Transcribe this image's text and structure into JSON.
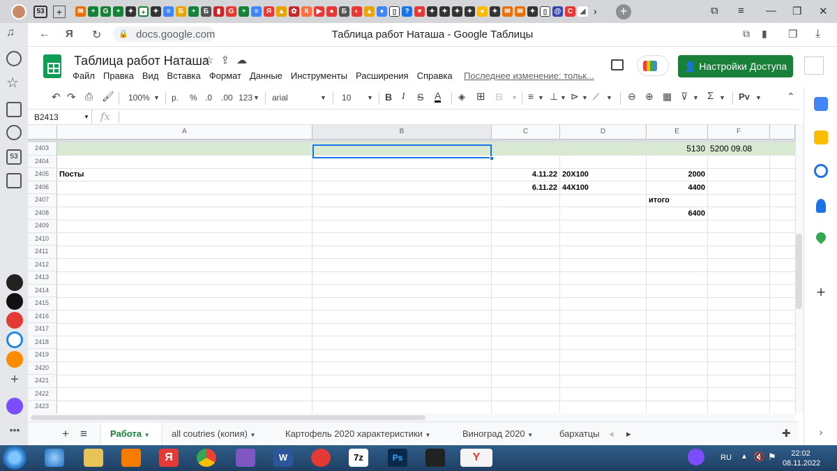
{
  "browser": {
    "tab_count": "53",
    "url": "docs.google.com",
    "page_title": "Таблица работ Наташа - Google Таблицы"
  },
  "doc": {
    "title": "Таблица работ Наташа",
    "menu": [
      "Файл",
      "Правка",
      "Вид",
      "Вставка",
      "Формат",
      "Данные",
      "Инструменты",
      "Расширения",
      "Справка"
    ],
    "last_edit": "Последнее изменение: тольк...",
    "share_label": "Настройки Доступа"
  },
  "toolbar": {
    "zoom": "100%",
    "currency": "р.",
    "percent": "%",
    "dec_less": ".0",
    "dec_more": ".00",
    "format_more": "123",
    "font": "arial",
    "font_size": "10"
  },
  "formula": {
    "namebox": "B2413",
    "fx": "fx"
  },
  "grid": {
    "columns": [
      "A",
      "B",
      "C",
      "D",
      "E",
      "F"
    ],
    "rows": [
      {
        "num": "2403",
        "a": "",
        "c": "",
        "d": "",
        "e": "5130",
        "f": "5200 09.08",
        "highlight": true
      },
      {
        "num": "2404",
        "a": "",
        "c": "",
        "d": "",
        "e": "",
        "f": ""
      },
      {
        "num": "2405",
        "a": "Посты",
        "c": "4.11.22",
        "d": "20X100",
        "e": "2000",
        "f": ""
      },
      {
        "num": "2406",
        "a": "",
        "c": "6.11.22",
        "d": "44X100",
        "e": "4400",
        "f": ""
      },
      {
        "num": "2407",
        "a": "",
        "c": "",
        "d": "",
        "e": "итого",
        "f": ""
      },
      {
        "num": "2408",
        "a": "",
        "c": "",
        "d": "",
        "e": "6400",
        "f": ""
      },
      {
        "num": "2409"
      },
      {
        "num": "2410"
      },
      {
        "num": "2411"
      },
      {
        "num": "2412"
      },
      {
        "num": "2413"
      },
      {
        "num": "2414"
      },
      {
        "num": "2415"
      },
      {
        "num": "2416"
      },
      {
        "num": "2417"
      },
      {
        "num": "2418"
      },
      {
        "num": "2419"
      },
      {
        "num": "2420"
      },
      {
        "num": "2421"
      },
      {
        "num": "2422"
      },
      {
        "num": "2423"
      }
    ]
  },
  "sheets": {
    "add": "+",
    "list": "≡",
    "tabs": [
      "Работа",
      "all coutries (копия)",
      "Картофель 2020 характеристики",
      "Виноград 2020",
      "бархатцы"
    ]
  },
  "taskbar": {
    "lang": "RU",
    "time": "22:02",
    "date": "08.11.2022"
  },
  "colors": {
    "sheets_green": "#188038",
    "highlight_row": "#d9ead3",
    "selection": "#1a73e8"
  }
}
